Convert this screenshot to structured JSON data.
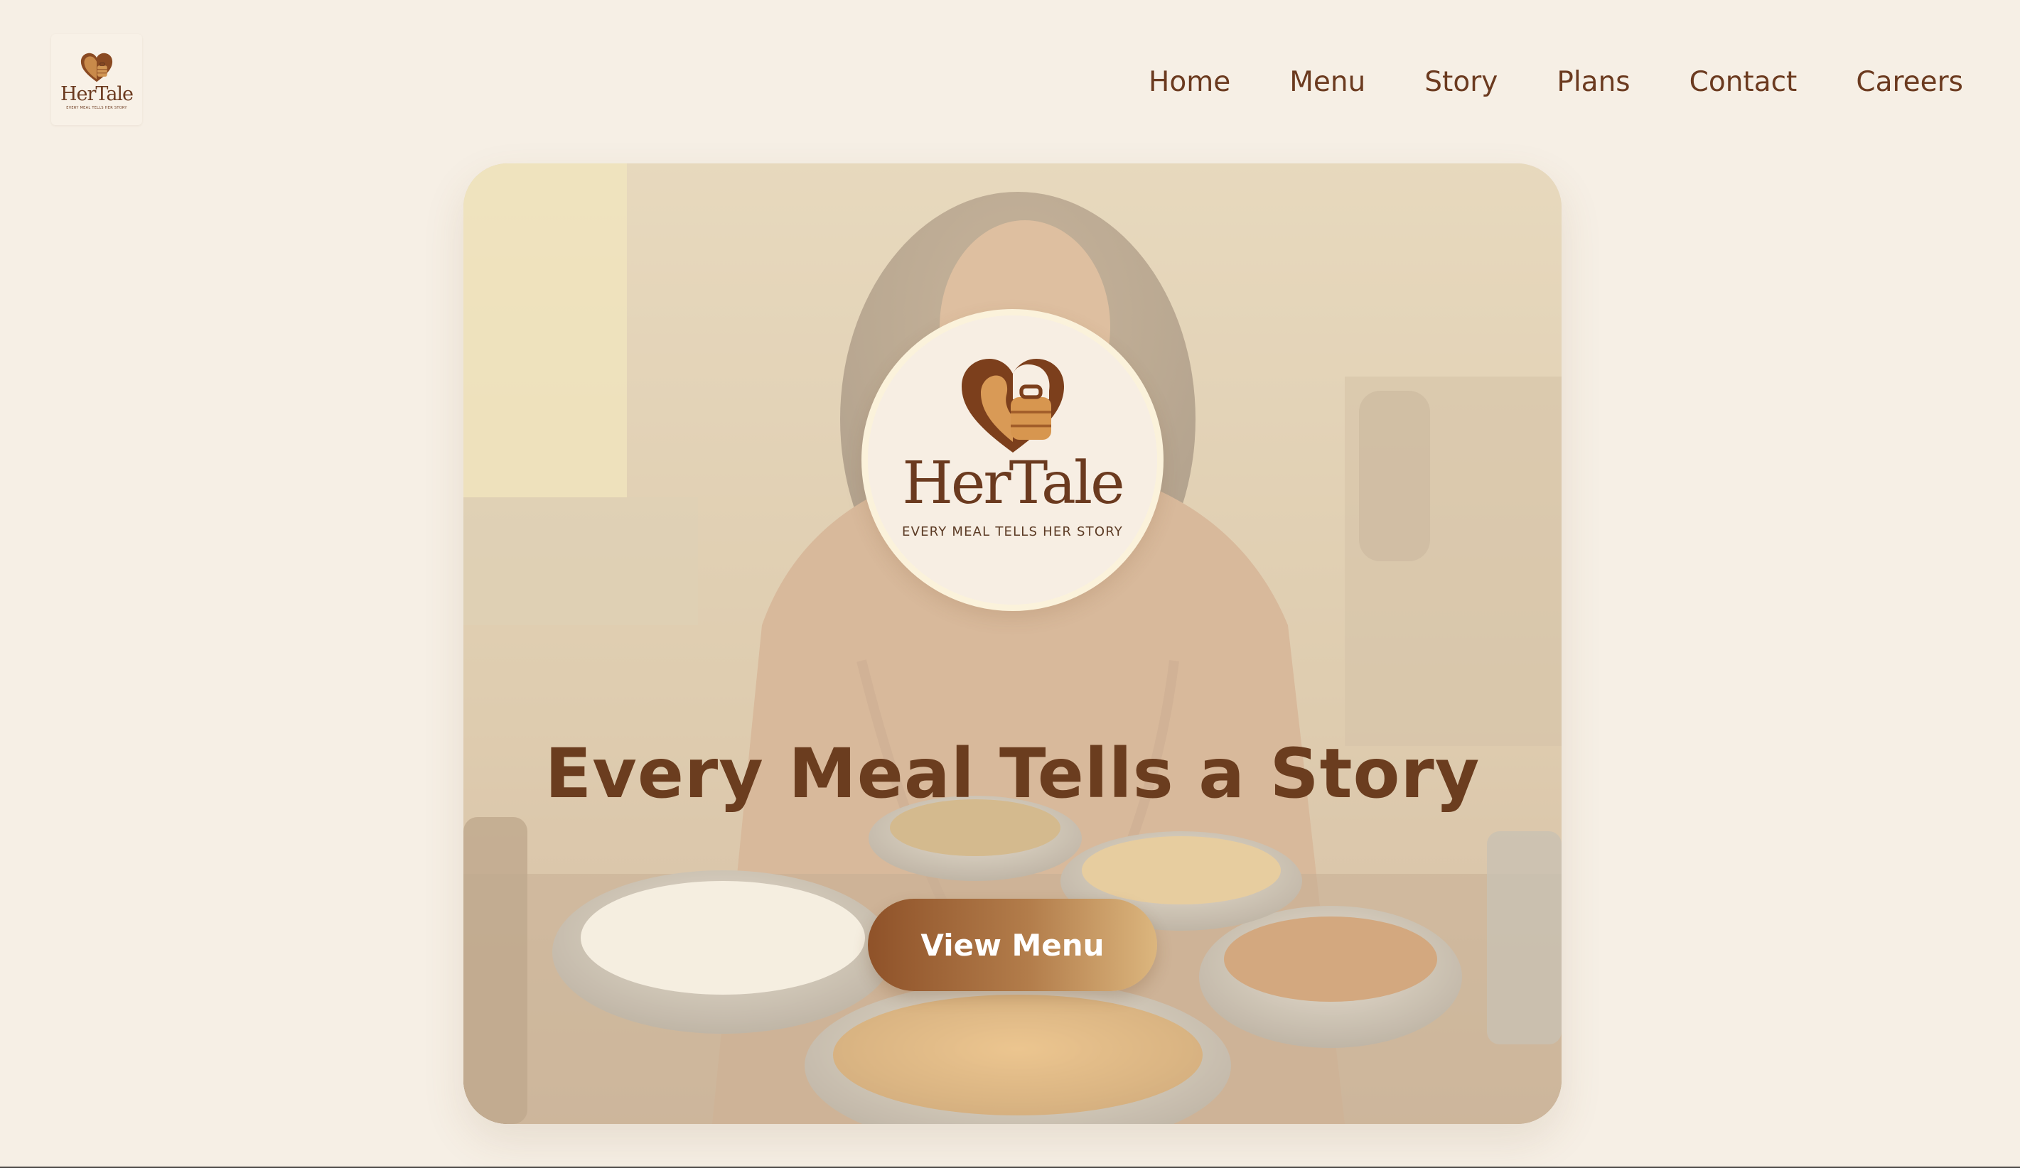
{
  "brand": {
    "name": "HerTale",
    "tagline": "EVERY MEAL TELLS HER STORY",
    "colors": {
      "brown": "#6b3a1f",
      "background": "#f6efe5",
      "gold": "#dcb67e"
    }
  },
  "nav": {
    "items": [
      {
        "label": "Home"
      },
      {
        "label": "Menu"
      },
      {
        "label": "Story"
      },
      {
        "label": "Plans"
      },
      {
        "label": "Contact"
      },
      {
        "label": "Careers"
      }
    ]
  },
  "hero": {
    "title": "Every Meal Tells a Story",
    "cta_label": "View Menu"
  }
}
